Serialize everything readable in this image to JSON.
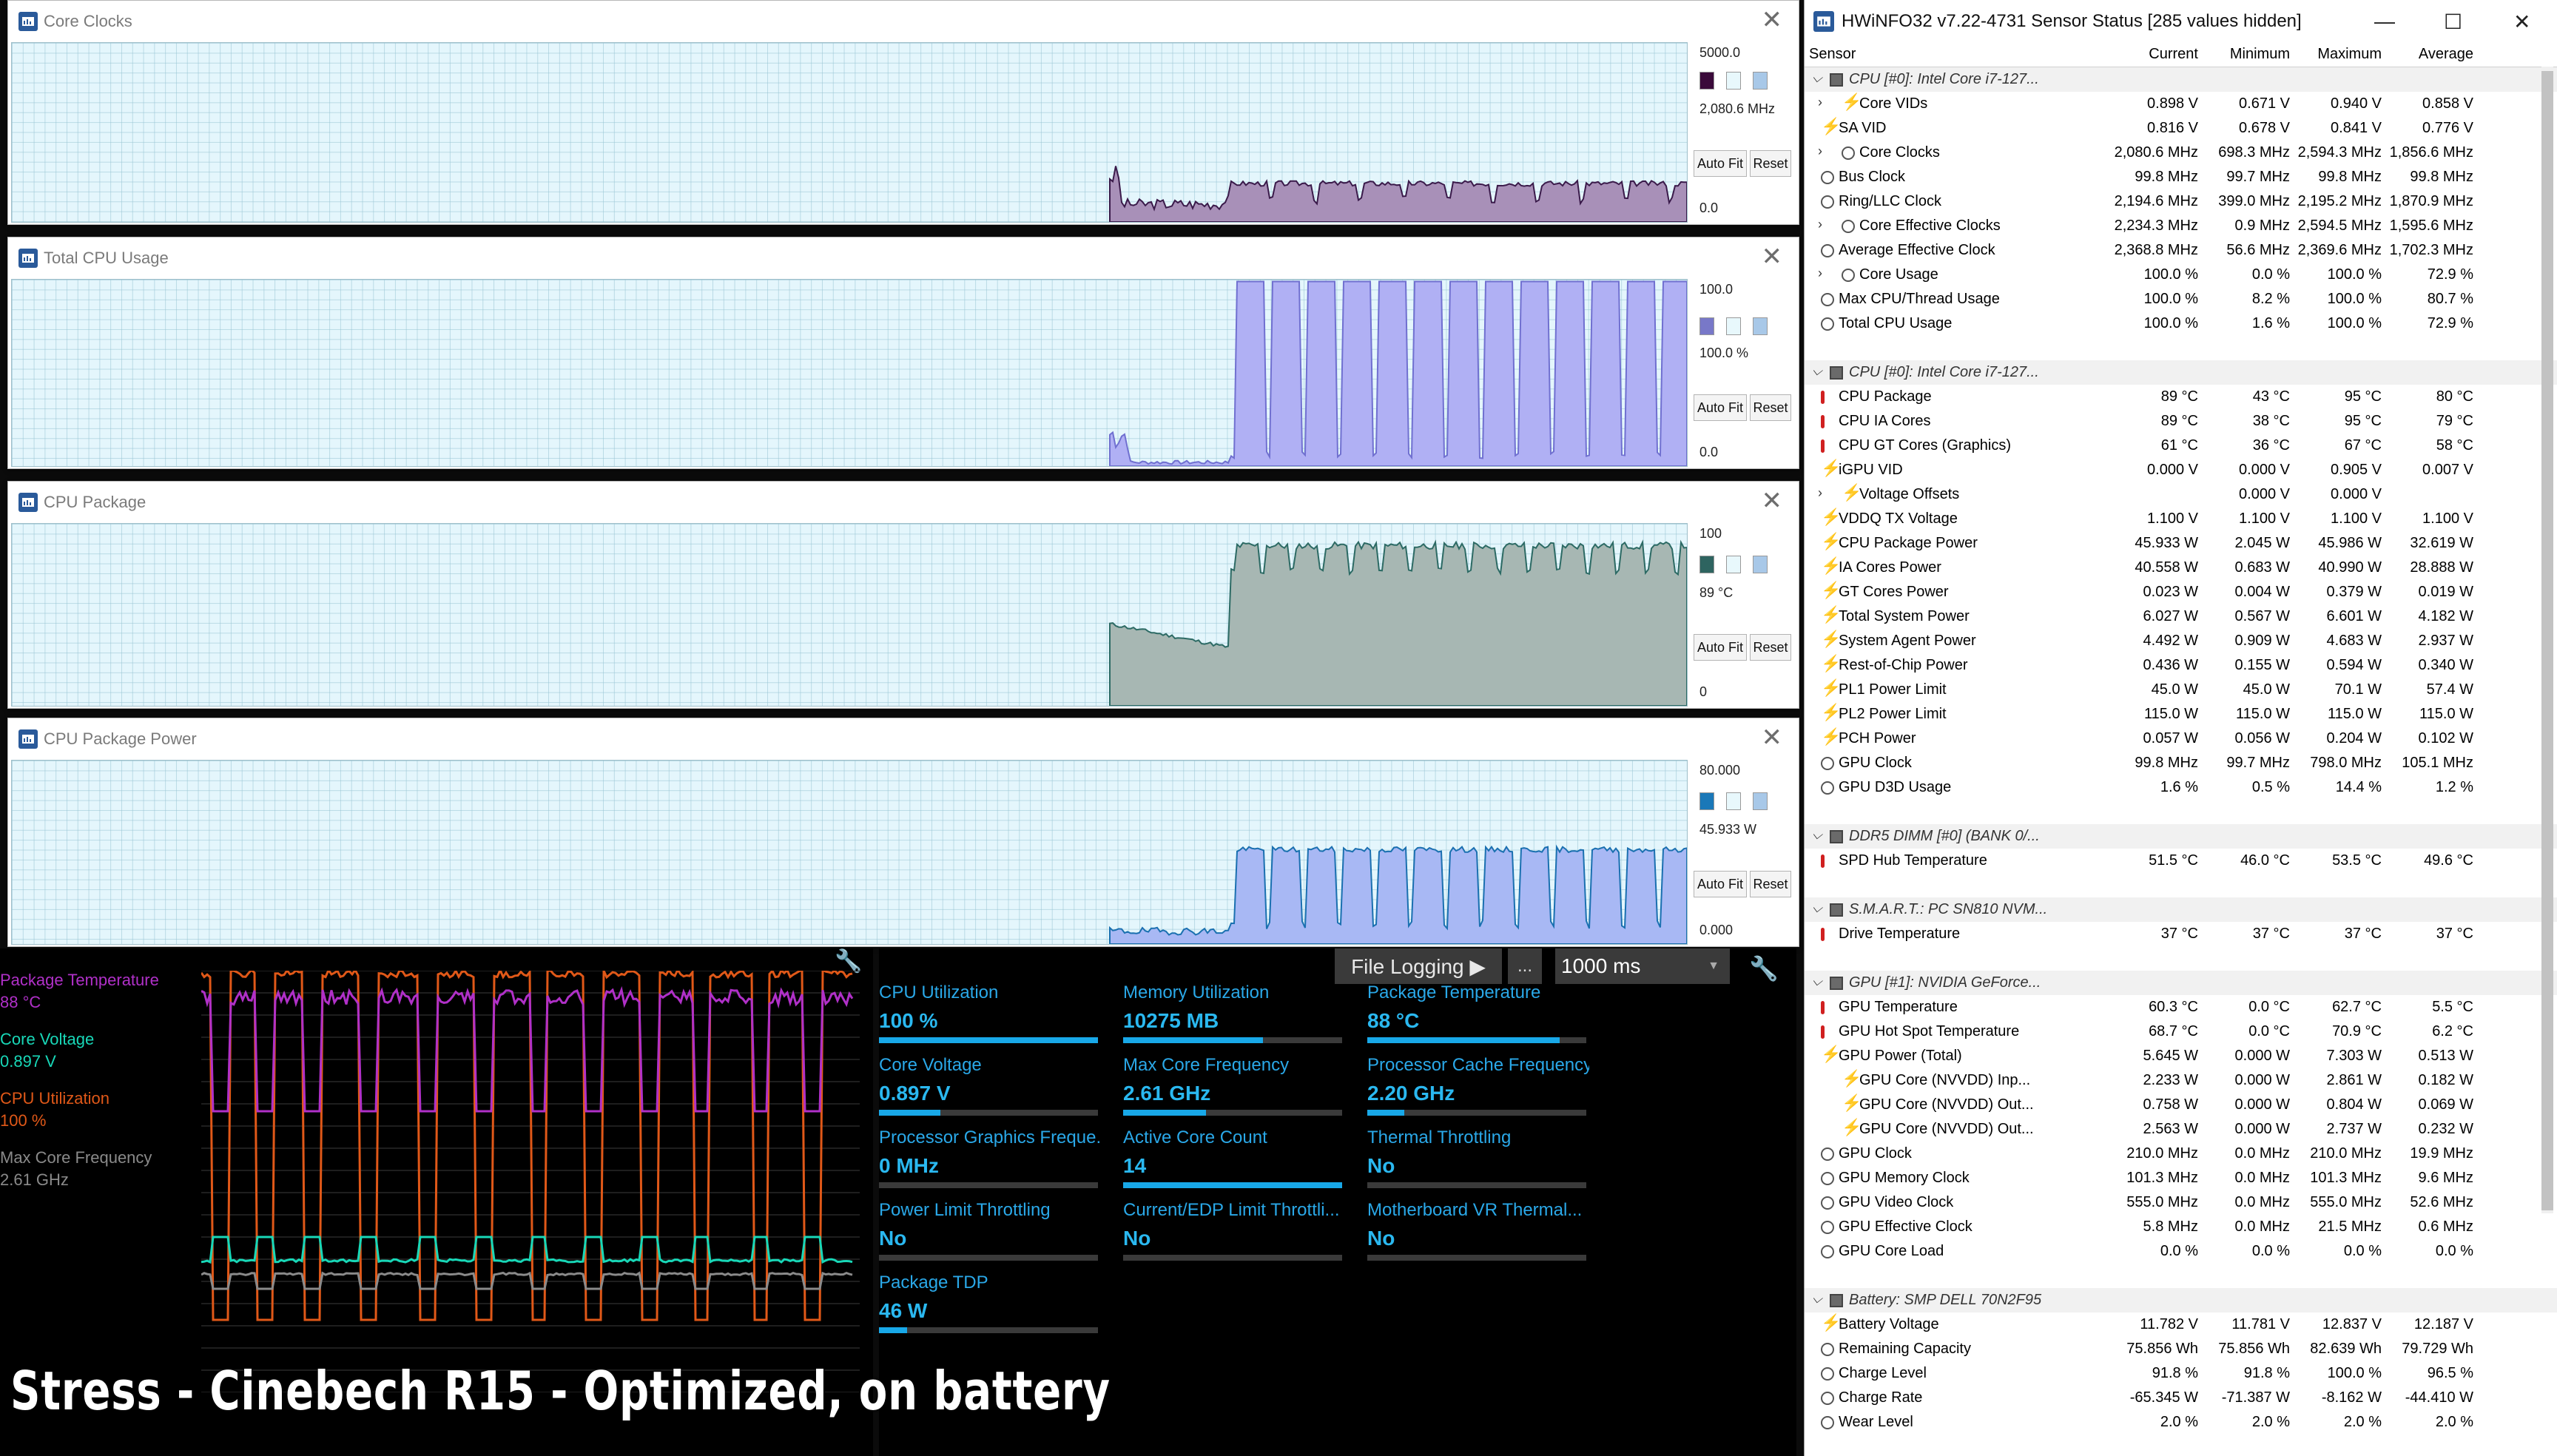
{
  "graph_windows": [
    {
      "id": "core-clocks",
      "title": "Core Clocks",
      "max": "5000.0",
      "current": "2,080.6 MHz",
      "min": "0.0",
      "line_color": "#3a1a4a",
      "fill_color": "#a890b8",
      "swatch": "#3a0a3a"
    },
    {
      "id": "total-cpu-usage",
      "title": "Total CPU Usage",
      "max": "100.0",
      "current": "100.0 %",
      "min": "0.0",
      "line_color": "#7070d0",
      "fill_color": "#b0b0f4",
      "swatch": "#7878c8"
    },
    {
      "id": "cpu-package",
      "title": "CPU Package",
      "max": "100",
      "current": "89 °C",
      "min": "0",
      "line_color": "#2c6a64",
      "fill_color": "#a7b7b3",
      "swatch": "#2e6460"
    },
    {
      "id": "cpu-package-power",
      "title": "CPU Package Power",
      "max": "80.000",
      "current": "45.933 W",
      "min": "0.000",
      "line_color": "#1a70b0",
      "fill_color": "#a8b8f4",
      "swatch": "#1a78b8"
    }
  ],
  "graph_buttons": {
    "auto_fit": "Auto Fit",
    "reset": "Reset"
  },
  "legend": [
    {
      "name": "Package Temperature",
      "value": "88 °C",
      "color": "#b030c8"
    },
    {
      "name": "Core Voltage",
      "value": "0.897 V",
      "color": "#18d8b8"
    },
    {
      "name": "CPU Utilization",
      "value": "100 %",
      "color": "#e05818"
    },
    {
      "name": "Max Core Frequency",
      "value": "2.61 GHz",
      "color": "#8a8a8a"
    }
  ],
  "toolbar": {
    "file_logging": "File Logging ▶",
    "ellipsis": "...",
    "interval": "1000 ms"
  },
  "metrics": [
    {
      "label": "CPU Utilization",
      "value": "100 %",
      "fill": 1.0
    },
    {
      "label": "Memory Utilization",
      "value": "10275  MB",
      "fill": 0.64
    },
    {
      "label": "Package Temperature",
      "value": "88 °C",
      "fill": 0.88
    },
    {
      "label": "Core Voltage",
      "value": "0.897 V",
      "fill": 0.28
    },
    {
      "label": "Max Core Frequency",
      "value": "2.61 GHz",
      "fill": 0.38
    },
    {
      "label": "Processor Cache Frequency",
      "value": "2.20 GHz",
      "fill": 0.17
    },
    {
      "label": "Processor Graphics Freque...",
      "value": "0 MHz",
      "fill": 0.0
    },
    {
      "label": "Active Core Count",
      "value": "14",
      "fill": 1.0
    },
    {
      "label": "Thermal Throttling",
      "value": "No",
      "fill": 0.0
    },
    {
      "label": "Power Limit Throttling",
      "value": "No",
      "fill": 0.0
    },
    {
      "label": "Current/EDP Limit Throttli...",
      "value": "No",
      "fill": 0.0
    },
    {
      "label": "Motherboard VR Thermal...",
      "value": "No",
      "fill": 0.0
    },
    {
      "label": "Package TDP",
      "value": "46 W",
      "fill": 0.13
    }
  ],
  "caption": "Stress - Cinebech R15 - Optimized, on battery",
  "hwinfo": {
    "title": "HWiNFO32 v7.22-4731 Sensor Status [285 values hidden]",
    "columns": [
      "Sensor",
      "Current",
      "Minimum",
      "Maximum",
      "Average"
    ],
    "rows": [
      {
        "t": "group",
        "label": "CPU [#0]: Intel Core i7-127..."
      },
      {
        "t": "bolt",
        "exp": true,
        "indent": 1,
        "label": "Core VIDs",
        "v": [
          "0.898 V",
          "0.671 V",
          "0.940 V",
          "0.858 V"
        ]
      },
      {
        "t": "bolt",
        "label": "SA VID",
        "v": [
          "0.816 V",
          "0.678 V",
          "0.841 V",
          "0.776 V"
        ]
      },
      {
        "t": "clock",
        "exp": true,
        "indent": 1,
        "label": "Core Clocks",
        "v": [
          "2,080.6 MHz",
          "698.3 MHz",
          "2,594.3 MHz",
          "1,856.6 MHz"
        ]
      },
      {
        "t": "clock",
        "label": "Bus Clock",
        "v": [
          "99.8 MHz",
          "99.7 MHz",
          "99.8 MHz",
          "99.8 MHz"
        ]
      },
      {
        "t": "clock",
        "label": "Ring/LLC Clock",
        "v": [
          "2,194.6 MHz",
          "399.0 MHz",
          "2,195.2 MHz",
          "1,870.9 MHz"
        ]
      },
      {
        "t": "clock",
        "exp": true,
        "indent": 1,
        "label": "Core Effective Clocks",
        "v": [
          "2,234.3 MHz",
          "0.9 MHz",
          "2,594.5 MHz",
          "1,595.6 MHz"
        ]
      },
      {
        "t": "clock",
        "label": "Average Effective Clock",
        "v": [
          "2,368.8 MHz",
          "56.6 MHz",
          "2,369.6 MHz",
          "1,702.3 MHz"
        ]
      },
      {
        "t": "clock",
        "exp": true,
        "indent": 1,
        "label": "Core Usage",
        "v": [
          "100.0 %",
          "0.0 %",
          "100.0 %",
          "72.9 %"
        ]
      },
      {
        "t": "clock",
        "label": "Max CPU/Thread Usage",
        "v": [
          "100.0 %",
          "8.2 %",
          "100.0 %",
          "80.7 %"
        ]
      },
      {
        "t": "clock",
        "label": "Total CPU Usage",
        "v": [
          "100.0 %",
          "1.6 %",
          "100.0 %",
          "72.9 %"
        ]
      },
      {
        "t": "blank"
      },
      {
        "t": "group",
        "label": "CPU [#0]: Intel Core i7-127..."
      },
      {
        "t": "therm",
        "label": "CPU Package",
        "v": [
          "89 °C",
          "43 °C",
          "95 °C",
          "80 °C"
        ]
      },
      {
        "t": "therm",
        "label": "CPU IA Cores",
        "v": [
          "89 °C",
          "38 °C",
          "95 °C",
          "79 °C"
        ]
      },
      {
        "t": "therm",
        "label": "CPU GT Cores (Graphics)",
        "v": [
          "61 °C",
          "36 °C",
          "67 °C",
          "58 °C"
        ]
      },
      {
        "t": "bolt",
        "label": "iGPU VID",
        "v": [
          "0.000 V",
          "0.000 V",
          "0.905 V",
          "0.007 V"
        ]
      },
      {
        "t": "bolt",
        "exp": true,
        "indent": 1,
        "label": "Voltage Offsets",
        "v": [
          "",
          "0.000 V",
          "0.000 V",
          ""
        ]
      },
      {
        "t": "bolt",
        "label": "VDDQ TX Voltage",
        "v": [
          "1.100 V",
          "1.100 V",
          "1.100 V",
          "1.100 V"
        ]
      },
      {
        "t": "bolt",
        "label": "CPU Package Power",
        "v": [
          "45.933 W",
          "2.045 W",
          "45.986 W",
          "32.619 W"
        ]
      },
      {
        "t": "bolt",
        "label": "IA Cores Power",
        "v": [
          "40.558 W",
          "0.683 W",
          "40.990 W",
          "28.888 W"
        ]
      },
      {
        "t": "bolt",
        "label": "GT Cores Power",
        "v": [
          "0.023 W",
          "0.004 W",
          "0.379 W",
          "0.019 W"
        ]
      },
      {
        "t": "bolt",
        "label": "Total System Power",
        "v": [
          "6.027 W",
          "0.567 W",
          "6.601 W",
          "4.182 W"
        ]
      },
      {
        "t": "bolt",
        "label": "System Agent Power",
        "v": [
          "4.492 W",
          "0.909 W",
          "4.683 W",
          "2.937 W"
        ]
      },
      {
        "t": "bolt",
        "label": "Rest-of-Chip Power",
        "v": [
          "0.436 W",
          "0.155 W",
          "0.594 W",
          "0.340 W"
        ]
      },
      {
        "t": "bolt",
        "label": "PL1 Power Limit",
        "v": [
          "45.0 W",
          "45.0 W",
          "70.1 W",
          "57.4 W"
        ]
      },
      {
        "t": "bolt",
        "label": "PL2 Power Limit",
        "v": [
          "115.0 W",
          "115.0 W",
          "115.0 W",
          "115.0 W"
        ]
      },
      {
        "t": "bolt",
        "label": "PCH Power",
        "v": [
          "0.057 W",
          "0.056 W",
          "0.204 W",
          "0.102 W"
        ]
      },
      {
        "t": "clock",
        "label": "GPU Clock",
        "v": [
          "99.8 MHz",
          "99.7 MHz",
          "798.0 MHz",
          "105.1 MHz"
        ]
      },
      {
        "t": "clock",
        "label": "GPU D3D Usage",
        "v": [
          "1.6 %",
          "0.5 %",
          "14.4 %",
          "1.2 %"
        ]
      },
      {
        "t": "blank"
      },
      {
        "t": "group",
        "label": "DDR5 DIMM [#0] (BANK 0/..."
      },
      {
        "t": "therm",
        "label": "SPD Hub Temperature",
        "v": [
          "51.5 °C",
          "46.0 °C",
          "53.5 °C",
          "49.6 °C"
        ]
      },
      {
        "t": "blank"
      },
      {
        "t": "group",
        "label": "S.M.A.R.T.: PC SN810 NVM..."
      },
      {
        "t": "therm",
        "label": "Drive Temperature",
        "v": [
          "37 °C",
          "37 °C",
          "37 °C",
          "37 °C"
        ]
      },
      {
        "t": "blank"
      },
      {
        "t": "group",
        "label": "GPU [#1]: NVIDIA GeForce..."
      },
      {
        "t": "therm",
        "label": "GPU Temperature",
        "v": [
          "60.3 °C",
          "0.0 °C",
          "62.7 °C",
          "5.5 °C"
        ]
      },
      {
        "t": "therm",
        "label": "GPU Hot Spot Temperature",
        "v": [
          "68.7 °C",
          "0.0 °C",
          "70.9 °C",
          "6.2 °C"
        ]
      },
      {
        "t": "bolt",
        "label": "GPU Power (Total)",
        "v": [
          "5.645 W",
          "0.000 W",
          "7.303 W",
          "0.513 W"
        ]
      },
      {
        "t": "bolt",
        "indent": 1,
        "label": "GPU Core (NVVDD) Inp...",
        "v": [
          "2.233 W",
          "0.000 W",
          "2.861 W",
          "0.182 W"
        ]
      },
      {
        "t": "bolt",
        "indent": 1,
        "label": "GPU Core (NVVDD) Out...",
        "v": [
          "0.758 W",
          "0.000 W",
          "0.804 W",
          "0.069 W"
        ]
      },
      {
        "t": "bolt",
        "indent": 1,
        "label": "GPU Core (NVVDD) Out...",
        "v": [
          "2.563 W",
          "0.000 W",
          "2.737 W",
          "0.232 W"
        ]
      },
      {
        "t": "clock",
        "label": "GPU Clock",
        "v": [
          "210.0 MHz",
          "0.0 MHz",
          "210.0 MHz",
          "19.9 MHz"
        ]
      },
      {
        "t": "clock",
        "label": "GPU Memory Clock",
        "v": [
          "101.3 MHz",
          "0.0 MHz",
          "101.3 MHz",
          "9.6 MHz"
        ]
      },
      {
        "t": "clock",
        "label": "GPU Video Clock",
        "v": [
          "555.0 MHz",
          "0.0 MHz",
          "555.0 MHz",
          "52.6 MHz"
        ]
      },
      {
        "t": "clock",
        "label": "GPU Effective Clock",
        "v": [
          "5.8 MHz",
          "0.0 MHz",
          "21.5 MHz",
          "0.6 MHz"
        ]
      },
      {
        "t": "clock",
        "label": "GPU Core Load",
        "v": [
          "0.0 %",
          "0.0 %",
          "0.0 %",
          "0.0 %"
        ]
      },
      {
        "t": "blank"
      },
      {
        "t": "group",
        "label": "Battery: SMP DELL 70N2F95"
      },
      {
        "t": "bolt",
        "label": "Battery Voltage",
        "v": [
          "11.782 V",
          "11.781 V",
          "12.837 V",
          "12.187 V"
        ]
      },
      {
        "t": "clock",
        "label": "Remaining Capacity",
        "v": [
          "75.856 Wh",
          "75.856 Wh",
          "82.639 Wh",
          "79.729 Wh"
        ]
      },
      {
        "t": "clock",
        "label": "Charge Level",
        "v": [
          "91.8 %",
          "91.8 %",
          "100.0 %",
          "96.5 %"
        ]
      },
      {
        "t": "clock",
        "label": "Charge Rate",
        "v": [
          "-65.345 W",
          "-71.387 W",
          "-8.162 W",
          "-44.410 W"
        ]
      },
      {
        "t": "clock",
        "label": "Wear Level",
        "v": [
          "2.0 %",
          "2.0 %",
          "2.0 %",
          "2.0 %"
        ]
      }
    ]
  }
}
